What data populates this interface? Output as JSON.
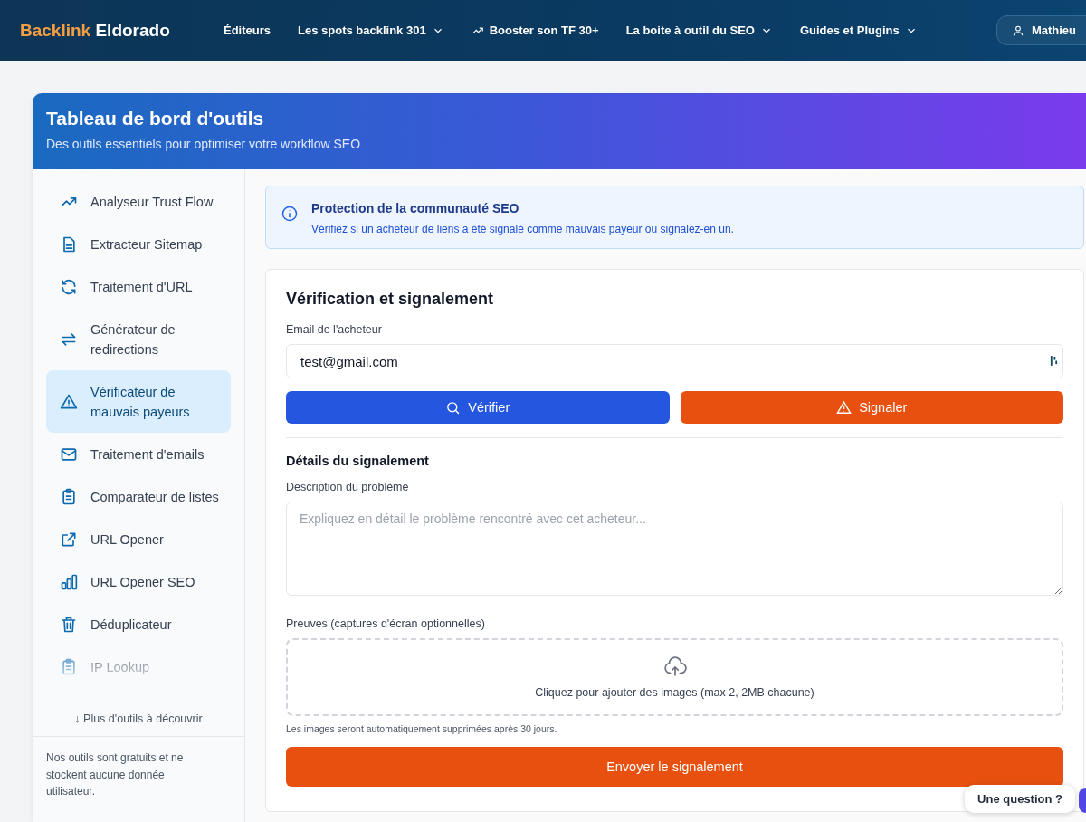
{
  "nav": {
    "logo_accent": "Backlink",
    "logo_rest": "Eldorado",
    "items": [
      {
        "label": "Éditeurs",
        "kind": "plain"
      },
      {
        "label": "Les spots backlink 301",
        "kind": "dropdown"
      },
      {
        "label": "Booster son TF 30+",
        "kind": "trend"
      },
      {
        "label": "La boite à outil du SEO",
        "kind": "dropdown"
      },
      {
        "label": "Guides et Plugins",
        "kind": "dropdown"
      }
    ],
    "user": "Mathieu"
  },
  "header": {
    "title": "Tableau de bord d'outils",
    "subtitle": "Des outils essentiels pour optimiser votre workflow SEO"
  },
  "sidebar": {
    "items": [
      {
        "label": "Analyseur Trust Flow",
        "kind": "trend",
        "selected": false
      },
      {
        "label": "Extracteur Sitemap",
        "kind": "file",
        "selected": false
      },
      {
        "label": "Traitement d'URL",
        "kind": "refresh",
        "selected": false
      },
      {
        "label": "Générateur de redirections",
        "kind": "swap",
        "selected": false
      },
      {
        "label": "Vérificateur de mauvais payeurs",
        "kind": "warning",
        "selected": true
      },
      {
        "label": "Traitement d'emails",
        "kind": "mail",
        "selected": false
      },
      {
        "label": "Comparateur de listes",
        "kind": "clipboard",
        "selected": false
      },
      {
        "label": "URL Opener",
        "kind": "external",
        "selected": false
      },
      {
        "label": "URL Opener SEO",
        "kind": "bars",
        "selected": false
      },
      {
        "label": "Déduplicateur",
        "kind": "trash",
        "selected": false
      },
      {
        "label": "IP Lookup",
        "kind": "clipboard",
        "selected": false
      }
    ],
    "more": "↓ Plus d'outils à découvrir",
    "footer": "Nos outils sont gratuits et ne stockent aucune donnée utilisateur."
  },
  "info": {
    "title": "Protection de la communauté SEO",
    "text": "Vérifiez si un acheteur de liens a été signalé comme mauvais payeur ou signalez-en un."
  },
  "form": {
    "title": "Vérification et signalement",
    "email_label": "Email de l'acheteur",
    "email_value": "test@gmail.com",
    "verify_button": "Vérifier",
    "report_button": "Signaler",
    "details_title": "Détails du signalement",
    "description_label": "Description du problème",
    "description_placeholder": "Expliquez en détail le problème rencontré avec cet acheteur...",
    "proofs_label": "Preuves (captures d'écran optionnelles)",
    "upload_text": "Cliquez pour ajouter des images (max 2, 2MB chacune)",
    "upload_note": "Les images seront automatiquement supprimées après 30 jours.",
    "submit_button": "Envoyer le signalement"
  },
  "chat": {
    "label": "Une question ?"
  }
}
